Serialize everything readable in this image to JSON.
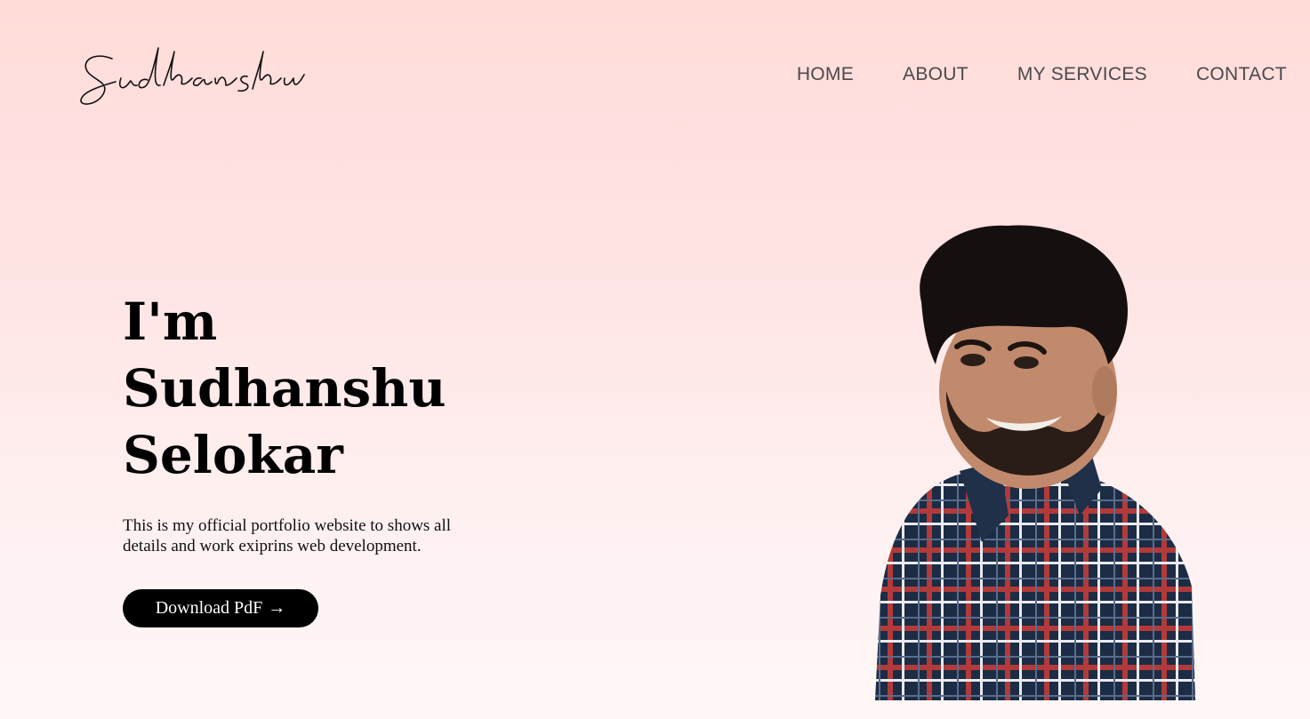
{
  "logo": {
    "text": "Sudhanshu"
  },
  "nav": {
    "items": [
      {
        "label": "HOME"
      },
      {
        "label": "ABOUT"
      },
      {
        "label": "MY SERVICES"
      },
      {
        "label": "CONTACT"
      }
    ]
  },
  "hero": {
    "title_line1": "I'm",
    "title_line2": "Sudhanshu",
    "title_line3": "Selokar",
    "description": "This is my official portfolio website to shows all details and work exiprins web development.",
    "button_label": "Download PdF",
    "button_arrow": "→"
  },
  "colors": {
    "background_top": "#ffdcd8",
    "background_bottom": "#fff7f7",
    "nav_text": "#4a4a4a",
    "button_bg": "#000000",
    "button_text": "#ffffff"
  },
  "icons": {
    "button_arrow_icon": "arrow-right-icon"
  }
}
